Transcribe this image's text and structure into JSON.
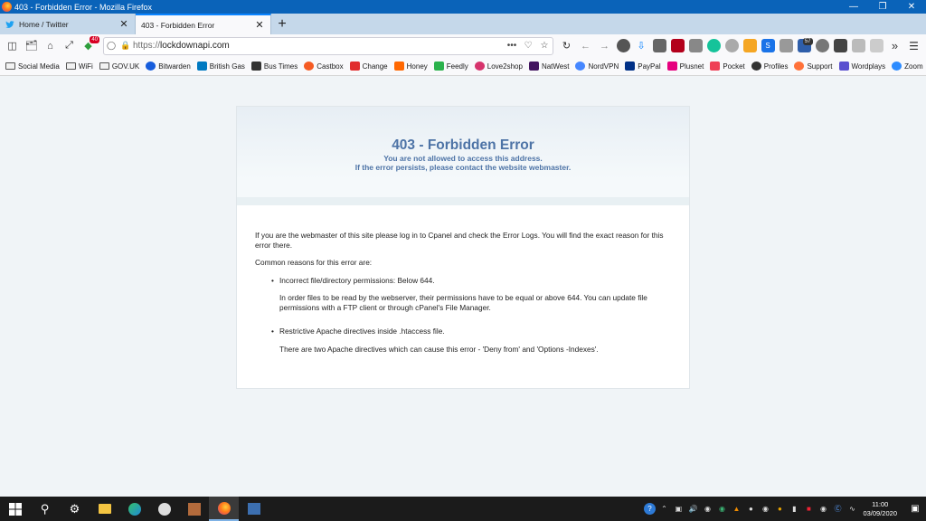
{
  "window": {
    "title": "403 - Forbidden Error - Mozilla Firefox"
  },
  "tabs": [
    {
      "label": "Home / Twitter",
      "active": false
    },
    {
      "label": "403 - Forbidden Error",
      "active": true
    }
  ],
  "nav": {
    "url_scheme": "https://",
    "url_host": "lockdownapi.com",
    "badge_count": "40",
    "ext_badge_count": "57"
  },
  "bookmarks": [
    {
      "label": "Social Media",
      "icon": "folder-icon"
    },
    {
      "label": "WiFi",
      "icon": "folder-icon"
    },
    {
      "label": "GOV.UK",
      "icon": "folder-icon"
    },
    {
      "label": "Bitwarden",
      "icon": "bitwarden-icon"
    },
    {
      "label": "British Gas",
      "icon": "british-gas-icon"
    },
    {
      "label": "Bus Times",
      "icon": "bus-icon"
    },
    {
      "label": "Castbox",
      "icon": "castbox-icon"
    },
    {
      "label": "Change",
      "icon": "change-icon"
    },
    {
      "label": "Honey",
      "icon": "honey-icon"
    },
    {
      "label": "Feedly",
      "icon": "feedly-icon"
    },
    {
      "label": "Love2shop",
      "icon": "love2shop-icon"
    },
    {
      "label": "NatWest",
      "icon": "natwest-icon"
    },
    {
      "label": "NordVPN",
      "icon": "nordvpn-icon"
    },
    {
      "label": "PayPal",
      "icon": "paypal-icon"
    },
    {
      "label": "Plusnet",
      "icon": "plusnet-icon"
    },
    {
      "label": "Pocket",
      "icon": "pocket-icon"
    },
    {
      "label": "Profiles",
      "icon": "profiles-icon"
    },
    {
      "label": "Support",
      "icon": "support-icon"
    },
    {
      "label": "Wordplays",
      "icon": "wordplays-icon"
    },
    {
      "label": "Zoom",
      "icon": "zoom-icon"
    }
  ],
  "error": {
    "title": "403 - Forbidden Error",
    "subtitle_1": "You are not allowed to access this address.",
    "subtitle_2": "If the error persists, please contact the website webmaster.",
    "intro": "If you are the webmaster of this site please log in to Cpanel and check the Error Logs. You will find the exact reason for this error there.",
    "common_reasons_heading": "Common reasons for this error are:",
    "reasons": [
      {
        "title": "Incorrect file/directory permissions: Below 644.",
        "detail": "In order files to be read by the webserver, their permissions have to be equal or above 644. You can update file permissions with a FTP client or through cPanel's File Manager."
      },
      {
        "title": "Restrictive Apache directives inside .htaccess file.",
        "detail": "There are two Apache directives which can cause this error - 'Deny from' and 'Options -Indexes'."
      }
    ]
  },
  "taskbar": {
    "time": "11:00",
    "date": "03/09/2020"
  },
  "colors": {
    "titlebar": "#0a63b9",
    "error_title": "#4d73a6",
    "taskbar": "#1b1b1b"
  }
}
